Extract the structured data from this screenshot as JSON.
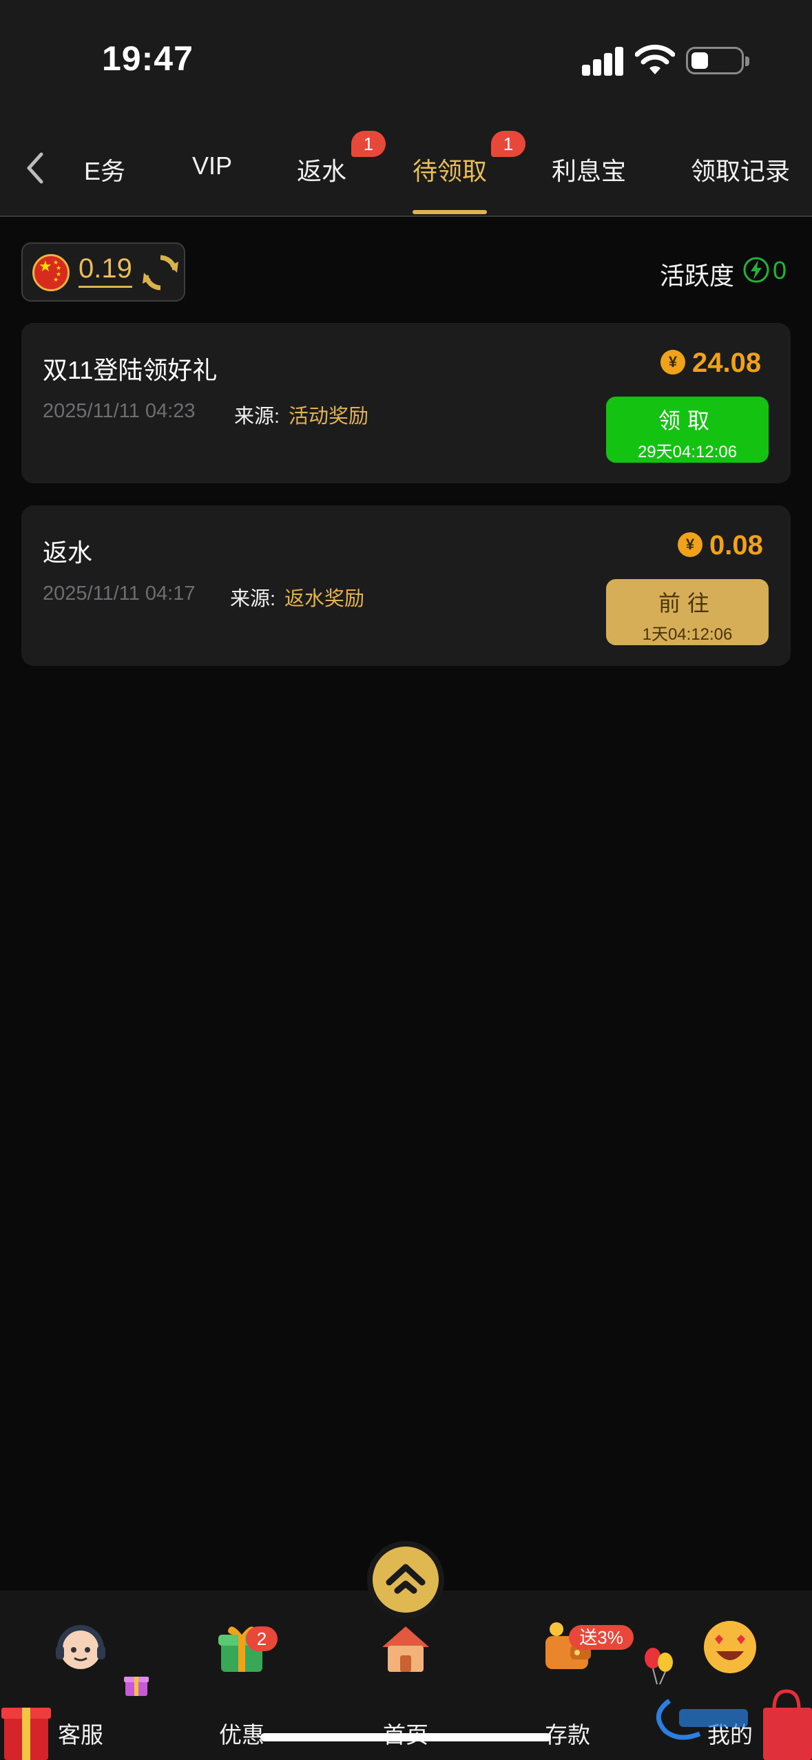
{
  "status_bar": {
    "time": "19:47"
  },
  "tabs": [
    {
      "label": "任务",
      "display": "E务",
      "badge": ""
    },
    {
      "label": "VIP",
      "badge": ""
    },
    {
      "label": "返水",
      "badge": "1"
    },
    {
      "label": "待领取",
      "badge": "1",
      "active": true
    },
    {
      "label": "利息宝",
      "badge": ""
    },
    {
      "label": "领取记录",
      "badge": ""
    }
  ],
  "balance": {
    "amount": "0.19",
    "currency_icon": "china-flag-icon"
  },
  "activity": {
    "label": "活跃度",
    "value": "0"
  },
  "claims": [
    {
      "title": "双11登陆领好礼",
      "date": "2025/11/11 04:23",
      "source_label": "来源:",
      "source": "活动奖励",
      "coin_symbol": "¥",
      "amount": "24.08",
      "button_label": "领取",
      "button_sub": "29天04:12:06",
      "button_color": "#14c212"
    },
    {
      "title": "返水",
      "date": "2025/11/11 04:17",
      "source_label": "来源:",
      "source": "返水奖励",
      "coin_symbol": "¥",
      "amount": "0.08",
      "button_label": "前往",
      "button_sub": "1天04:12:06",
      "button_color": "#d6ae57"
    }
  ],
  "bottom_nav": {
    "items": [
      {
        "label": "客服",
        "icon": "customer-service-icon",
        "badge": ""
      },
      {
        "label": "优惠",
        "icon": "gift-icon",
        "badge": "2"
      },
      {
        "label": "首页",
        "icon": "home-icon",
        "badge": ""
      },
      {
        "label": "存款",
        "icon": "wallet-icon",
        "badge": "送3%"
      },
      {
        "label": "我的",
        "icon": "smiley-icon",
        "badge": ""
      }
    ]
  },
  "colors": {
    "accent": "#e2b34f",
    "badge": "#e8483a",
    "amount": "#f0a31a",
    "active_green": "#23b33a"
  }
}
